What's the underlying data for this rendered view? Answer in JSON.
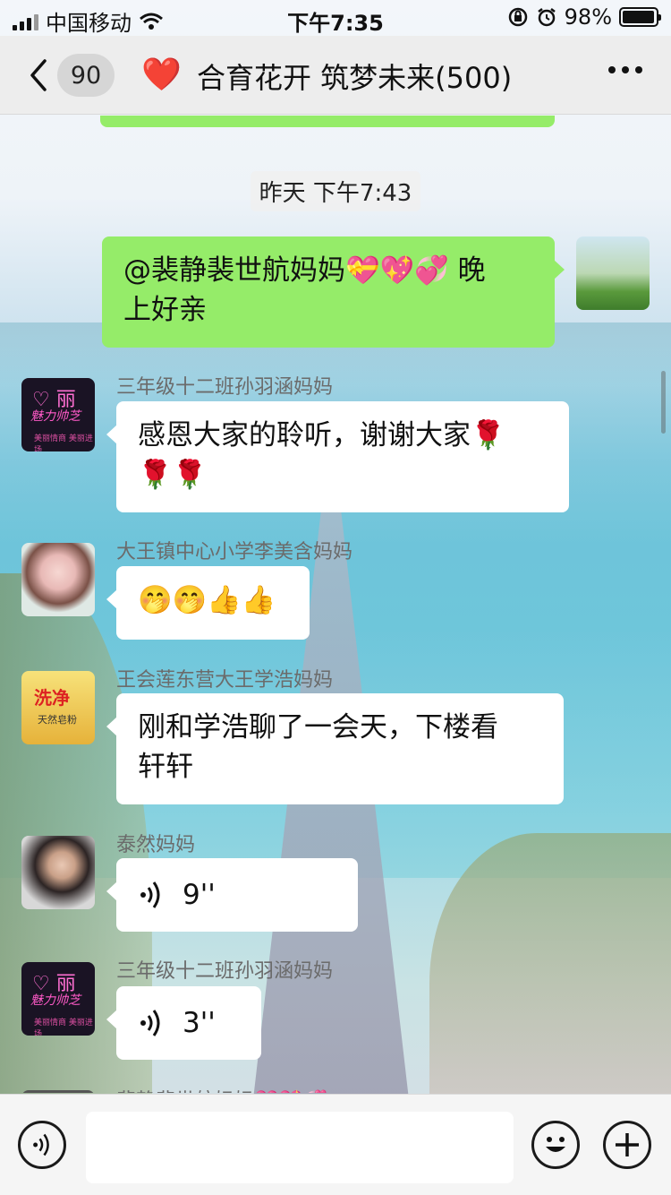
{
  "status_bar": {
    "carrier": "中国移动",
    "time": "下午7:35",
    "battery": "98%",
    "battery_level": 0.98,
    "icons": [
      "signal-icon",
      "wifi-icon",
      "orientation-lock-icon",
      "alarm-icon",
      "battery-icon"
    ]
  },
  "nav": {
    "unread_count": "90",
    "title_emoji": "❤️",
    "title": "合育花开 筑梦未来(500)",
    "icons": [
      "back-chevron-icon",
      "more-dots-icon"
    ]
  },
  "chat": {
    "timestamp": "昨天 下午7:43",
    "messages": [
      {
        "from": "self",
        "text": "@裴静裴世航妈妈💝💖💞 晚上好亲",
        "line1": "@裴静裴世航妈妈💝💖💞 晚",
        "line2": "上好亲"
      },
      {
        "sender": "三年级十二班孙羽涵妈妈",
        "text": "感恩大家的聆听，谢谢大家🌹🌹🌹",
        "line1": "感恩大家的聆听，谢谢大家🌹",
        "line2": "🌹🌹",
        "avatar_text": {
          "top": "♡ 丽",
          "mid": "魅力帅芝",
          "bottom": "美丽情商 美丽进场"
        }
      },
      {
        "sender": "大王镇中心小学李美含妈妈",
        "text": "🤭🤭👍👍"
      },
      {
        "sender": "王会莲东营大王学浩妈妈",
        "text": "刚和学浩聊了一会天，下楼看轩轩",
        "line1": "刚和学浩聊了一会天，下楼看",
        "line2": "轩轩",
        "avatar_text": {
          "brand": "洗净",
          "sub": "天然皂粉"
        }
      },
      {
        "sender": "泰然妈妈",
        "voice_duration": "9''"
      },
      {
        "sender": "三年级十二班孙羽涵妈妈",
        "voice_duration": "3''",
        "avatar_text": {
          "top": "♡ 丽",
          "mid": "魅力帅芝",
          "bottom": "美丽情商 美丽进场"
        }
      },
      {
        "sender": "裴静裴世航妈妈💝💖💞"
      }
    ]
  },
  "input_bar": {
    "value": "",
    "icons": [
      "voice-input-icon",
      "emoji-icon",
      "plus-icon"
    ]
  }
}
